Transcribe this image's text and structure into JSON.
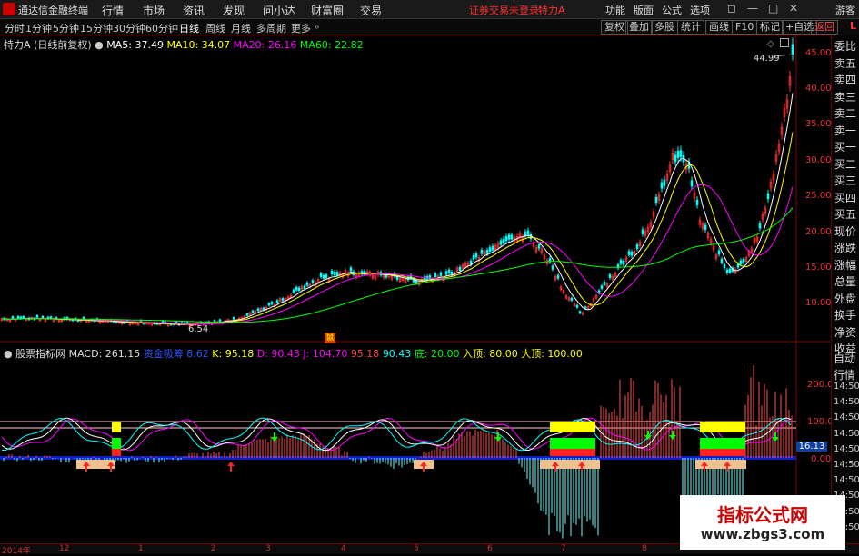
{
  "titlebar": {
    "app_name": "通达信金融终端",
    "menus": [
      "行情",
      "市场",
      "资讯",
      "发现",
      "问小达",
      "财富圈",
      "交易"
    ],
    "notice": "证券交易未登录",
    "stock": "特力A",
    "right_menus": [
      "功能",
      "版面",
      "公式",
      "选项"
    ],
    "guest": "游客"
  },
  "periods": [
    "分时",
    "1分钟",
    "5分钟",
    "15分钟",
    "30分钟",
    "60分钟",
    "日线",
    "周线",
    "月线",
    "多周期",
    "更多"
  ],
  "active_period": "日线",
  "tools": [
    "复权",
    "叠加",
    "多股",
    "统计",
    "画线",
    "F10",
    "标记",
    "+自选",
    "返回"
  ],
  "main_info": {
    "name": "特力A",
    "adjust": "(日线前复权)",
    "ma5": "MA5: 37.49",
    "ma10": "MA10: 34.07",
    "ma20": "MA20: 26.16",
    "ma60": "MA60: 22.82"
  },
  "price_axis": [
    "45.00",
    "40.00",
    "35.00",
    "30.00",
    "25.00",
    "20.00",
    "15.00",
    "10.00"
  ],
  "annotations": {
    "high": "44.99",
    "low": "6.54",
    "flag": "鼠"
  },
  "indicator_info": {
    "name": "股票指标网",
    "macd": "MACD: 261.15",
    "s2": "资金吸筹",
    "s2v": "8.62",
    "k": "K: 95.18",
    "d": "D: 90.43",
    "j": "J: 104.70",
    "v1": "95.18",
    "v2": "90.43",
    "bottom": "底: 20.00",
    "enter": "入顶: 80.00",
    "big_top": "大顶: 100.00"
  },
  "ind_axis": [
    "200.0",
    "100.0",
    "0.00"
  ],
  "ind_badge": "16.13",
  "right_panel_top": "L",
  "right_panel": [
    "委比",
    "卖五",
    "卖四",
    "卖三",
    "卖二",
    "卖一",
    "买一",
    "买二",
    "买三",
    "买四",
    "买五",
    "现价",
    "涨跌",
    "涨幅",
    "总量",
    "外盘",
    "换手",
    "净资",
    "收益"
  ],
  "right_panel_bottom": [
    "自动",
    "行情",
    "14:50",
    "14:50",
    "14:50",
    "14:50",
    "14:50",
    "14:50",
    "14:50",
    "14:50",
    "14:50",
    "14:50"
  ],
  "time_axis": [
    "2014年",
    "12",
    "1",
    "2",
    "3",
    "4",
    "5",
    "6",
    "7",
    "8"
  ],
  "watermark": {
    "title": "指标公式网",
    "url": "www.zbgs3.com"
  },
  "colors": {
    "bg": "#000000",
    "up": "#ff3333",
    "down": "#00ffff",
    "ma5": "#ffffff",
    "ma10": "#ffff00",
    "ma20": "#ff00ff",
    "ma60": "#00ff00"
  }
}
